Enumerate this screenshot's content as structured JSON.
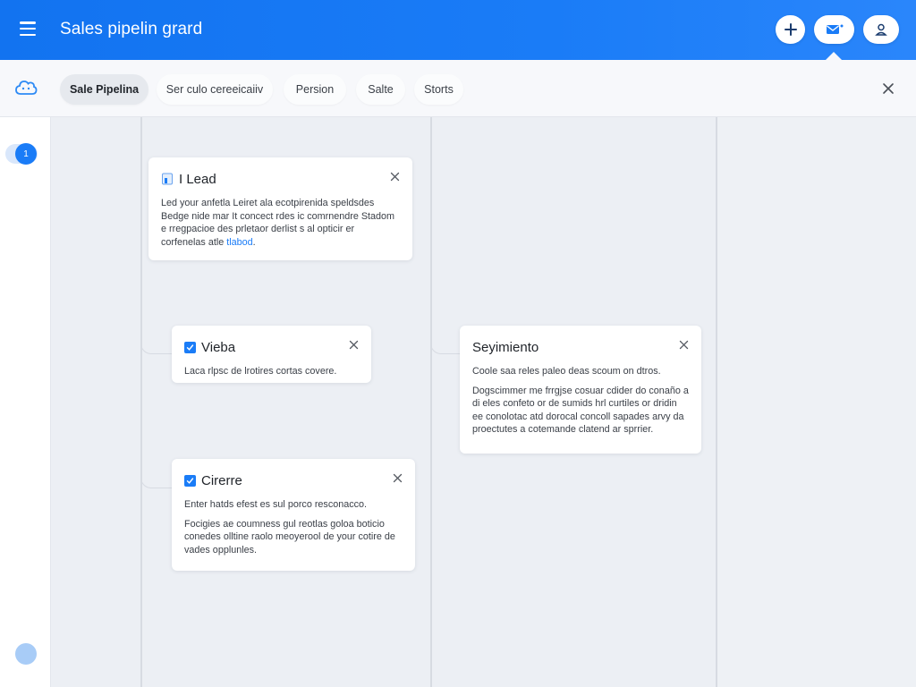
{
  "header": {
    "title": "Sales pipelin grard",
    "menu_icon": "hamburger-icon",
    "buttons": [
      {
        "name": "add-button",
        "icon": "plus-icon"
      },
      {
        "name": "messages-button",
        "icon": "mail-icon"
      },
      {
        "name": "profile-button",
        "icon": "user-icon"
      }
    ]
  },
  "tabs": [
    {
      "label": "Sale Pipelina",
      "active": true
    },
    {
      "label": "Ser culo cereeicaiiv",
      "active": false
    },
    {
      "label": "Persion",
      "active": false
    },
    {
      "label": "Salte",
      "active": false
    },
    {
      "label": "Storts",
      "active": false
    }
  ],
  "rail": {
    "badge": "1"
  },
  "cards": {
    "lead": {
      "title": "I Lead",
      "text": "Led your anfetla Leiret ala ecotpirenida speldsdes Bedge nide mar It concect rdes ic comrnendre Stadom e rregpacioe des prletaor derlist s al opticir er corfenelas atle",
      "link": "tlabod",
      "after_link": "."
    },
    "vieba": {
      "title": "Vieba",
      "text": "Laca rlpsc de lrotires cortas covere."
    },
    "seguimiento": {
      "title": "Seyimiento",
      "text1": "Coole saa reles paleo deas scoum on dtros.",
      "text2": "Dogscimmer me frrgjse cosuar cdider do conaño a di eles confeto or de sumids hrl curtiles or dridin ee conolotac atd dorocal concoll sapades arvy da proectutes a cotemande clatend ar sprrier."
    },
    "cierre": {
      "title": "Cirerre",
      "text1": "Enter hatds efest es sul porco resconacco.",
      "text2": "Focigies ae coumness gul reotlas goloa boticio conedes olltine raolo meoyerool de your cotire de vades opplunles."
    }
  },
  "colors": {
    "accent": "#1a7cf7",
    "header": "#1273f0",
    "background": "#eceff4"
  }
}
